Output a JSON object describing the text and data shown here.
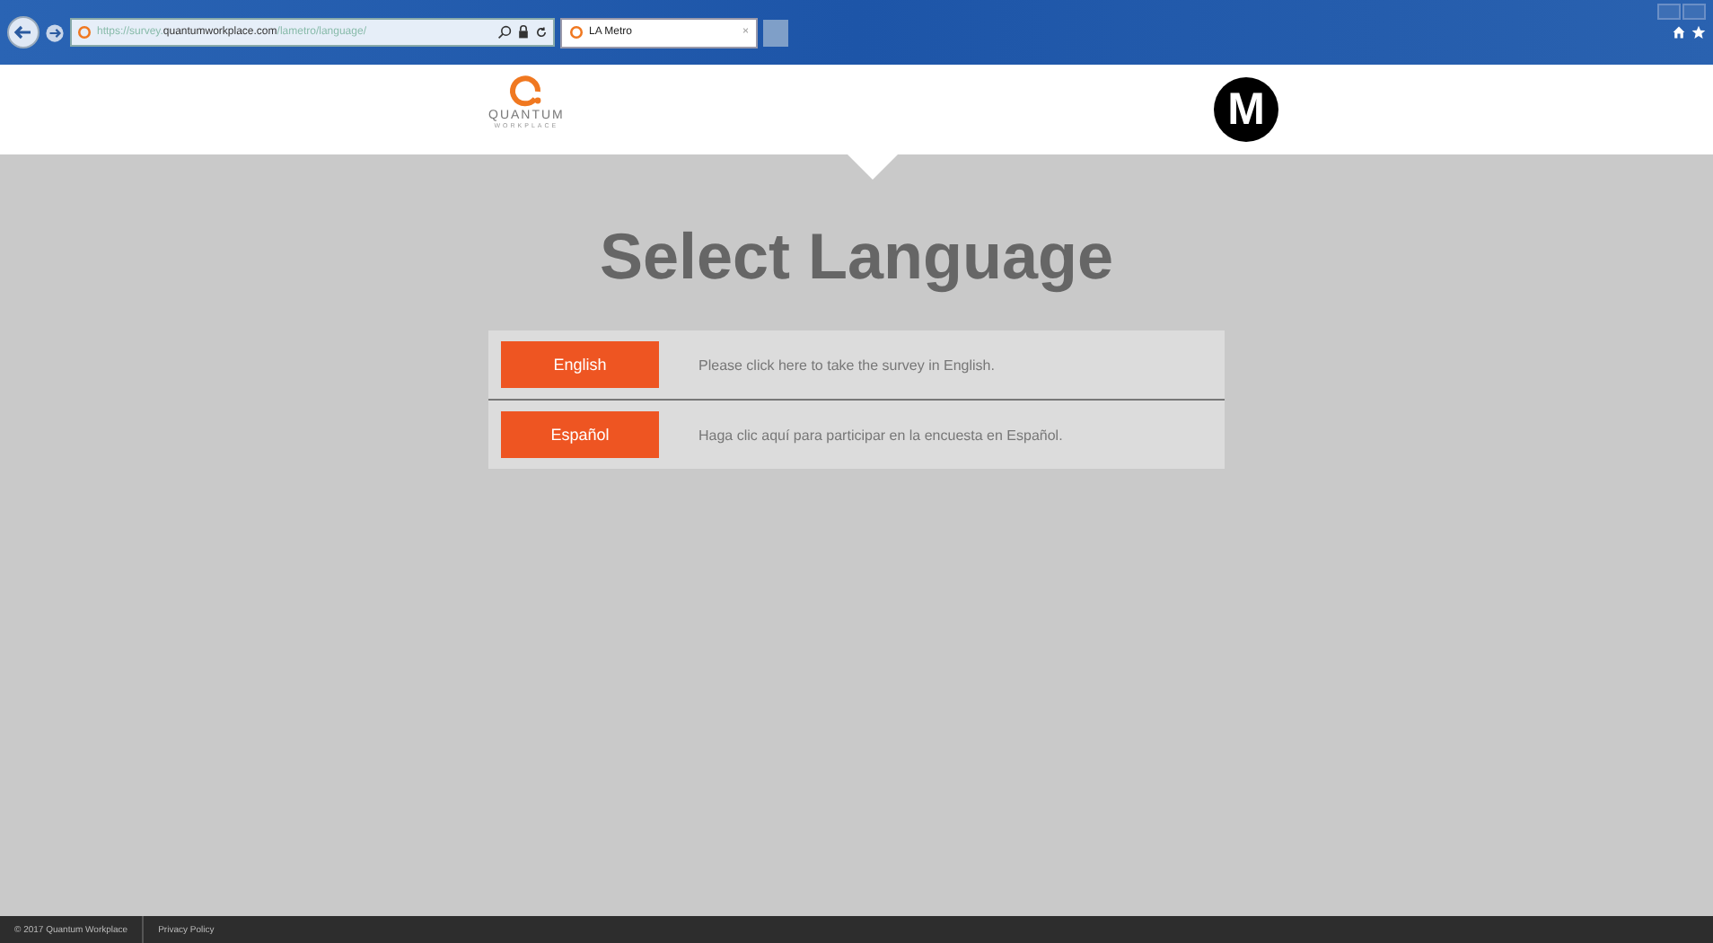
{
  "browser": {
    "url_prefix": "https://survey.",
    "url_domain": "quantumworkplace.com",
    "url_path": "/lametro/language/",
    "tab": {
      "title": "LA Metro",
      "close": "×"
    }
  },
  "header": {
    "brand": "QUANTUM",
    "brand_sub": "WORKPLACE",
    "partner_logo": "M"
  },
  "title": "Select Language",
  "options": [
    {
      "button": "English",
      "description": "Please click here to take the survey in English."
    },
    {
      "button": "Español",
      "description": "Haga clic aquí para participar en la encuesta en Español."
    }
  ],
  "footer": {
    "copyright": "© 2017 Quantum Workplace",
    "link": "Privacy Policy"
  }
}
